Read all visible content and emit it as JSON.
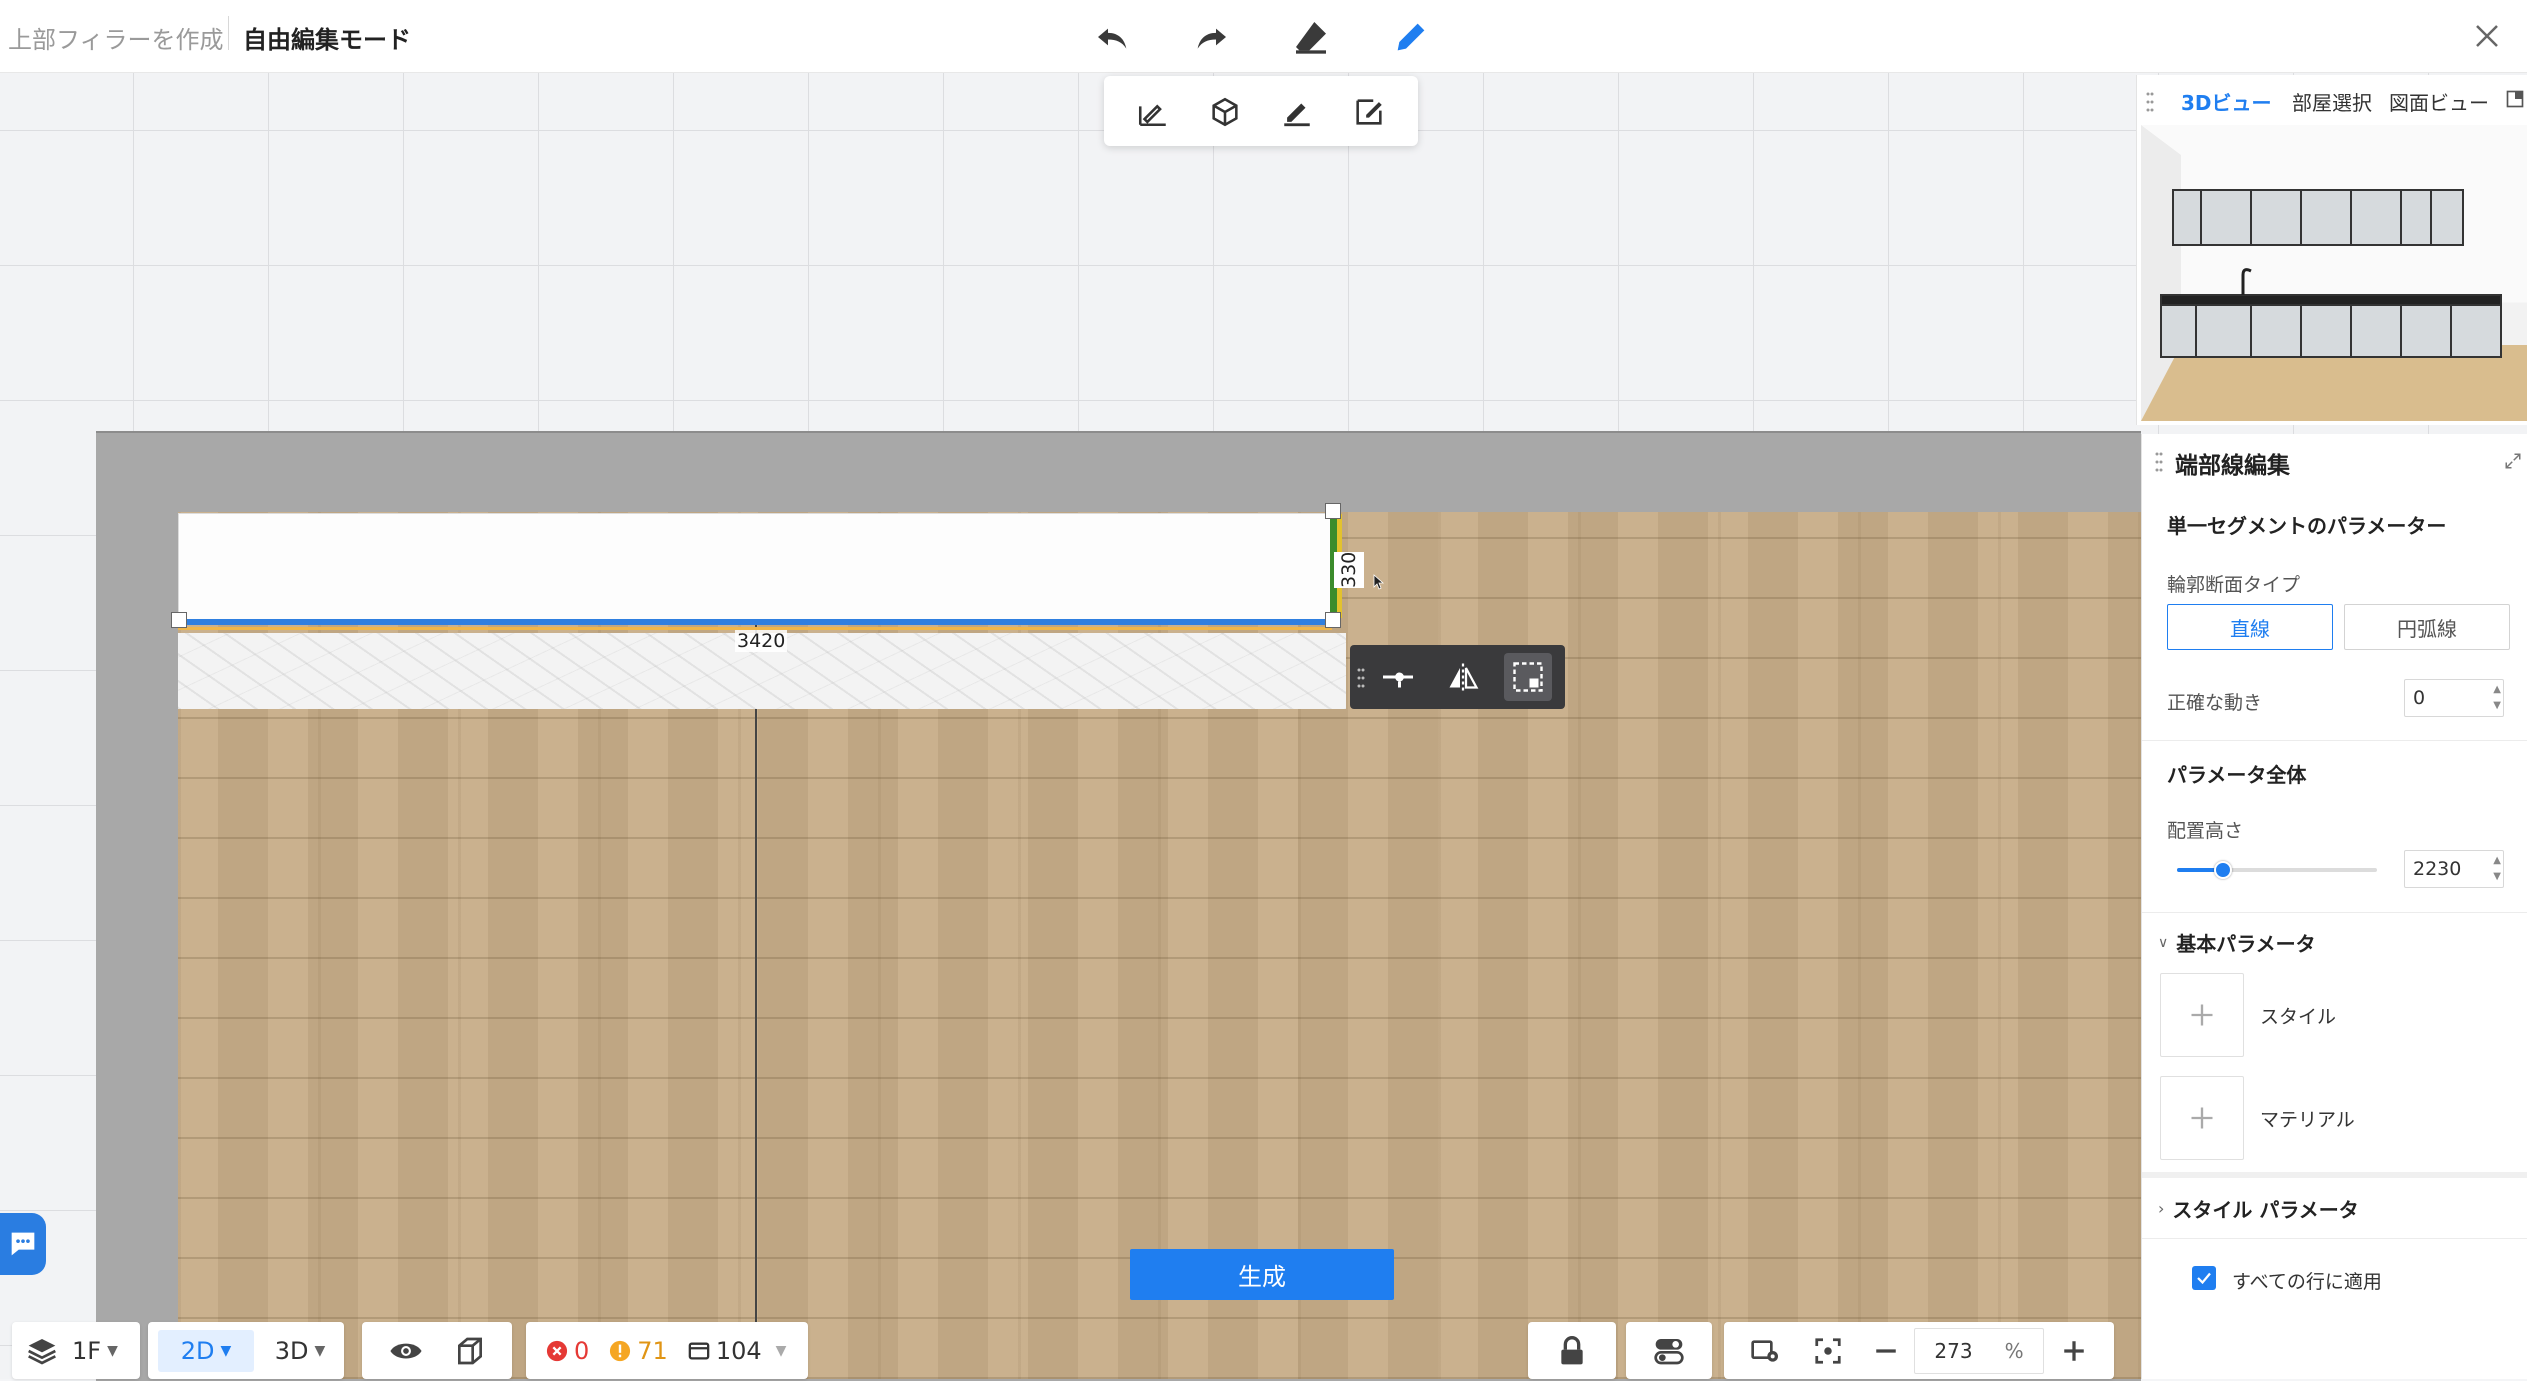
{
  "topbar": {
    "breadcrumb_prev": "上部フィラーを作成",
    "breadcrumb_current": "自由編集モード",
    "tools": [
      "undo-icon",
      "redo-icon",
      "eraser-icon",
      "pen-icon"
    ],
    "active_tool_color": "#1f7ef0"
  },
  "subtoolbar": {
    "tools": [
      "draw-line-icon",
      "cube-icon",
      "edit-icon",
      "edit-frame-icon"
    ]
  },
  "canvas": {
    "dimension_width": "3420",
    "dimension_height": "330",
    "generate_button": "生成"
  },
  "bottom_bar": {
    "floor_label": "1F",
    "view_2d": "2D",
    "view_3d": "3D",
    "errors": "0",
    "warnings": "71",
    "items": "104",
    "zoom_value": "273",
    "zoom_unit": "%"
  },
  "view_panel": {
    "tabs": [
      "3Dビュー",
      "部屋選択",
      "図面ビュー"
    ],
    "active_tab": "3Dビュー"
  },
  "edit_panel": {
    "title": "端部線編集",
    "single_segment_title": "単一セグメントのパラメーター",
    "profile_type_label": "輪郭断面タイプ",
    "profile_options": [
      "直線",
      "円弧線"
    ],
    "profile_selected": "直線",
    "precise_move_label": "正確な動き",
    "precise_move_value": "0",
    "overall_title": "パラメータ全体",
    "height_label": "配置高さ",
    "height_value": "2230",
    "height_slider_fraction": 0.23,
    "basic_params_title": "基本パラメータ",
    "style_label": "スタイル",
    "material_label": "マテリアル",
    "style_params_title": "スタイル パラメータ",
    "apply_all_label": "すべての行に適用",
    "apply_all_checked": true
  },
  "colors": {
    "accent": "#1f7ef0",
    "error": "#e53935",
    "warning": "#f5a623",
    "floor": "#c7ad88",
    "wall": "#a8a8a8"
  }
}
